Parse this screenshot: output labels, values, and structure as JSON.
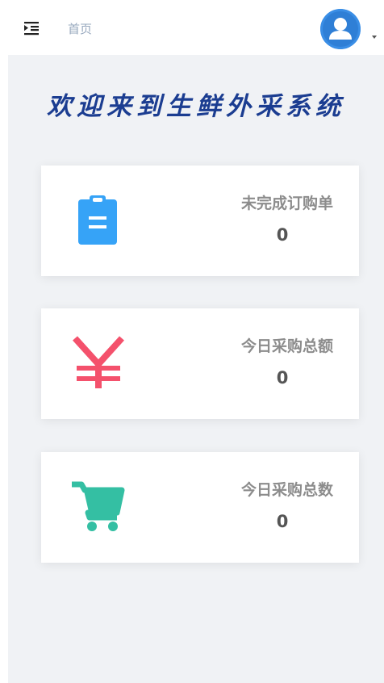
{
  "header": {
    "breadcrumb": "首页",
    "menu_icon": "indent-menu-icon",
    "avatar_icon": "user-avatar-icon",
    "avatar_color": "#3a8ee6"
  },
  "welcome": {
    "title": "欢迎来到生鲜外采系统",
    "color": "#1b3d91"
  },
  "cards": [
    {
      "label": "未完成订购单",
      "value": "0",
      "icon": "clipboard-icon",
      "color": "#36a3f7"
    },
    {
      "label": "今日采购总额",
      "value": "0",
      "icon": "yen-icon",
      "color": "#f4516c"
    },
    {
      "label": "今日采购总数",
      "value": "0",
      "icon": "shopping-cart-icon",
      "color": "#34bfa3"
    }
  ]
}
